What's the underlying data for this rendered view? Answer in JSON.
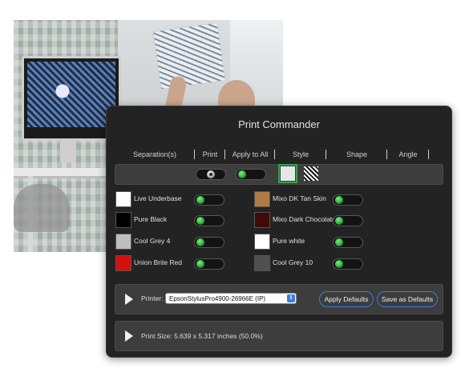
{
  "panel": {
    "title": "Print Commander",
    "columns": [
      "Separation(s)",
      "Print",
      "Apply to All",
      "Style",
      "Shape",
      "Angle"
    ]
  },
  "controls": {
    "print_toggle_state": "off",
    "apply_to_all_state": "on",
    "style_selected": "solid"
  },
  "separations": [
    {
      "name": "Live Underbase",
      "color": "#ffffff",
      "print": "on"
    },
    {
      "name": "Pure Black",
      "color": "#000000",
      "print": "on"
    },
    {
      "name": "Cool Grey 4",
      "color": "#bdbdbd",
      "print": "on"
    },
    {
      "name": "Union Brite Red",
      "color": "#d31010",
      "print": "on"
    },
    {
      "name": "Mixo DK Tan Skin",
      "color": "#b07a44",
      "print": "on"
    },
    {
      "name": "Mixo Dark Chocolate",
      "color": "#3f0b06",
      "print": "on"
    },
    {
      "name": "Pure white",
      "color": "#ffffff",
      "print": "on"
    },
    {
      "name": "Cool Grey 10",
      "color": "#505050",
      "print": "on"
    }
  ],
  "printer": {
    "label": "Printer:",
    "selected": "EpsonStylusPro4900-26966E (IP)",
    "apply_defaults": "Apply Defaults",
    "save_defaults": "Save as Defaults"
  },
  "print_size": {
    "text": "Print Size: 5.639 x 5.317 inches (50.0%)"
  },
  "colors": {
    "accent": "#3a7be0",
    "toggle_on": "#2aa84a"
  }
}
